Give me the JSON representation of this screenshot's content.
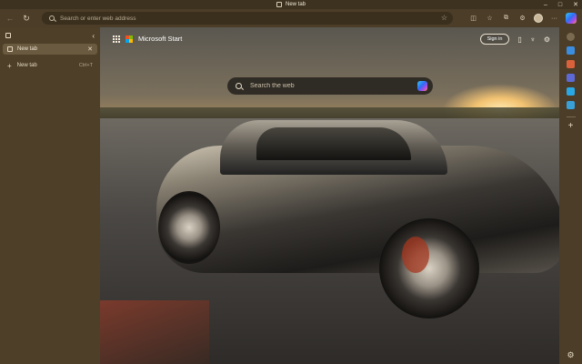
{
  "window": {
    "title": "New tab"
  },
  "toolbar": {
    "back_icon": "back-arrow-icon",
    "refresh_icon": "refresh-icon",
    "address_placeholder": "Search or enter web address",
    "right_icons": [
      "split-screen-icon",
      "favorites-icon",
      "collections-icon",
      "extensions-icon",
      "profile-avatar",
      "more-icon",
      "copilot-icon"
    ]
  },
  "sidebar": {
    "tabs": [
      {
        "label": "New tab"
      }
    ],
    "new_tab": {
      "label": "New tab",
      "shortcut": "Ctrl+T"
    }
  },
  "newtab": {
    "brand": "Microsoft Start",
    "signin_label": "Sign in",
    "search_placeholder": "Search the web"
  },
  "colors": {
    "chrome": "#4b3d27",
    "sidebar": "#4e3f28",
    "accent": "#2f6df6"
  }
}
